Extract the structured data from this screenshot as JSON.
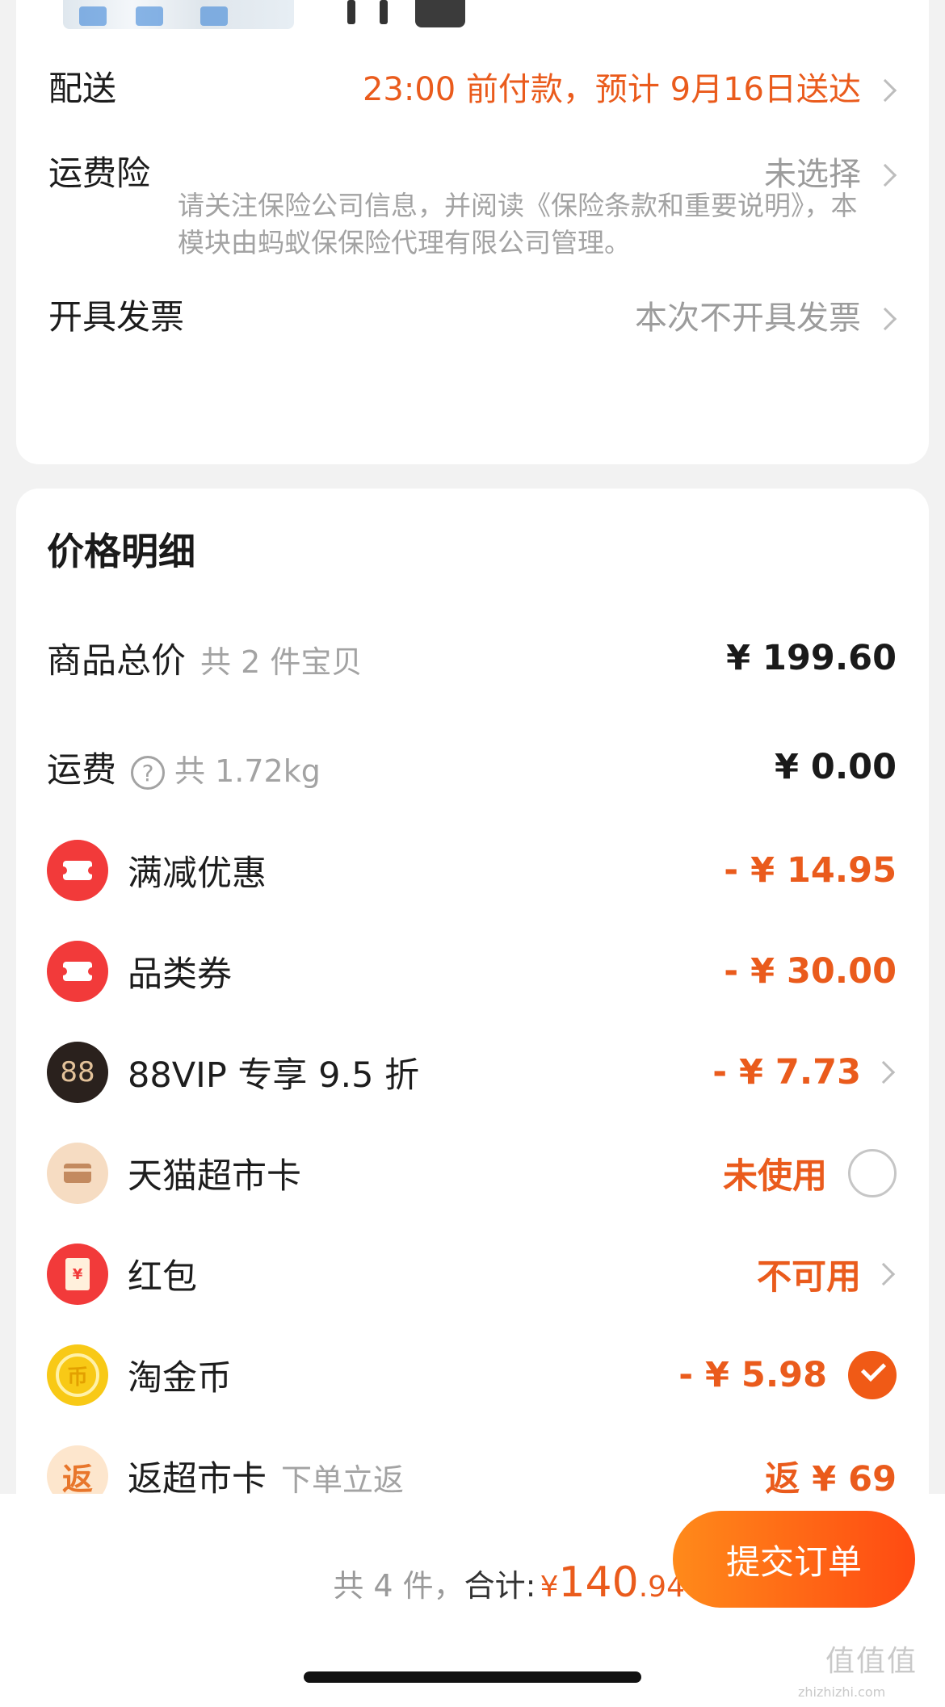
{
  "top_card": {
    "delivery": {
      "label": "配送",
      "value": "23:00 前付款，预计 9月16日送达"
    },
    "shipping_insurance": {
      "label": "运费险",
      "value": "未选择",
      "note": "请关注保险公司信息，并阅读《保险条款和重要说明》，本模块由蚂蚁保保险代理有限公司管理。"
    },
    "invoice": {
      "label": "开具发票",
      "value": "本次不开具发票"
    }
  },
  "price_detail": {
    "title": "价格明细",
    "goods_total": {
      "label": "商品总价",
      "sub": "共 2 件宝贝",
      "amount": "¥ 199.60"
    },
    "freight": {
      "label": "运费",
      "help_icon": "?",
      "sub": "共 1.72kg",
      "amount": "¥ 0.00"
    },
    "discounts": [
      {
        "icon": "coupon-icon",
        "label": "满减优惠",
        "amount": "- ¥ 14.95"
      },
      {
        "icon": "coupon-icon",
        "label": "品类券",
        "amount": "- ¥ 30.00"
      },
      {
        "icon": "88vip-icon",
        "icon_text": "88",
        "label": "88VIP 专享 9.5 折",
        "amount": "- ¥ 7.73"
      },
      {
        "icon": "card-icon",
        "label": "天猫超市卡",
        "amount": "未使用"
      },
      {
        "icon": "red-envelope-icon",
        "icon_text": "¥",
        "label": "红包",
        "amount": "不可用"
      },
      {
        "icon": "coin-icon",
        "icon_text": "币",
        "label": "淘金币",
        "amount": "- ¥ 5.98"
      },
      {
        "icon": "rebate-icon",
        "icon_text": "返",
        "label": "返超市卡",
        "sub": "下单立返",
        "amount": "返 ¥ 69"
      }
    ]
  },
  "bottom_bar": {
    "count_text": "共 4 件，",
    "total_label": "合计:",
    "currency": "¥",
    "total_int": "140",
    "total_dec": ".94",
    "submit_label": "提交订单"
  },
  "watermark": {
    "text": "值值值",
    "sub": "zhizhizhi.com"
  },
  "colors": {
    "accent": "#ea5b1c",
    "button_start": "#ff8a1a",
    "button_end": "#ff4a12"
  }
}
